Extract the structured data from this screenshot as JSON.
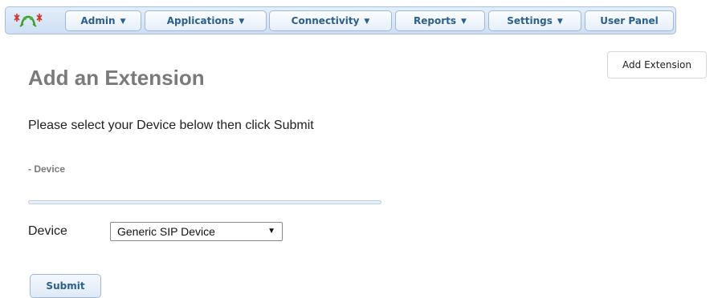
{
  "nav": {
    "items": [
      {
        "label": "Admin",
        "has_dropdown": true
      },
      {
        "label": "Applications",
        "has_dropdown": true
      },
      {
        "label": "Connectivity",
        "has_dropdown": true
      },
      {
        "label": "Reports",
        "has_dropdown": true
      },
      {
        "label": "Settings",
        "has_dropdown": true
      },
      {
        "label": "User Panel",
        "has_dropdown": false
      }
    ],
    "caret": "▼",
    "logo_icon": "frog-logo-icon"
  },
  "main": {
    "add_extension_label": "Add Extension",
    "title": "Add an Extension",
    "instructions": "Please select your Device below then click Submit",
    "section_label": "- Device",
    "device_label": "Device",
    "device_select": {
      "selected": "Generic SIP Device",
      "arrow": "▼"
    },
    "submit_label": "Submit"
  },
  "colors": {
    "nav_text": "#2b5f8e",
    "nav_bg": "#cfdff2",
    "title": "#7a7a7a"
  }
}
